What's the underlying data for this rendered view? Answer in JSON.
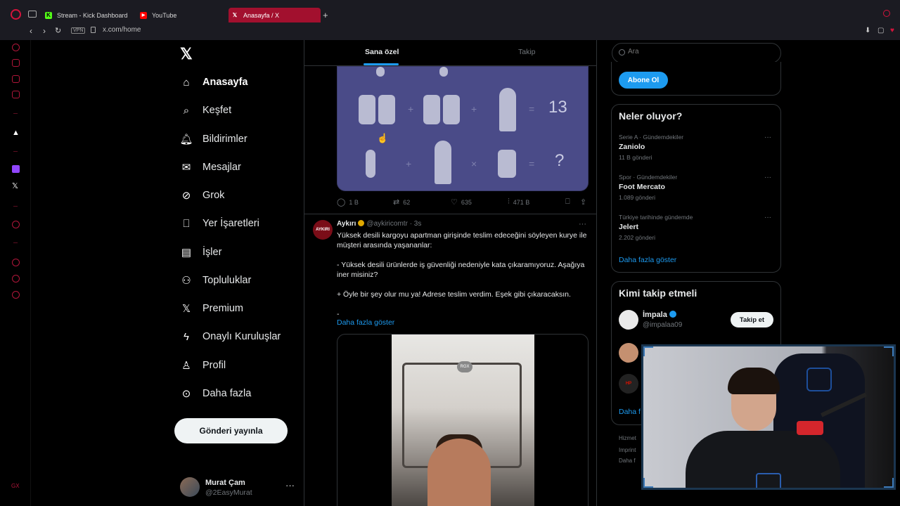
{
  "browser": {
    "tabs": [
      {
        "label": "Stream - Kick Dashboard",
        "icon": "kick-icon",
        "color": "#53fc18"
      },
      {
        "label": "YouTube",
        "icon": "youtube-icon",
        "color": "#ff0000"
      },
      {
        "label": "Anasayfa / X",
        "icon": "x-icon",
        "active": true
      }
    ],
    "vpn_label": "VPN",
    "url": "x.com/home"
  },
  "nav": {
    "items": [
      {
        "label": "Anasayfa",
        "icon": "home-icon",
        "active": true
      },
      {
        "label": "Keşfet",
        "icon": "search-icon"
      },
      {
        "label": "Bildirimler",
        "icon": "bell-icon"
      },
      {
        "label": "Mesajlar",
        "icon": "mail-icon"
      },
      {
        "label": "Grok",
        "icon": "grok-icon"
      },
      {
        "label": "Yer İşaretleri",
        "icon": "bookmark-icon"
      },
      {
        "label": "İşler",
        "icon": "briefcase-icon"
      },
      {
        "label": "Topluluklar",
        "icon": "communities-icon"
      },
      {
        "label": "Premium",
        "icon": "x-icon"
      },
      {
        "label": "Onaylı Kuruluşlar",
        "icon": "lightning-icon"
      },
      {
        "label": "Profil",
        "icon": "person-icon"
      },
      {
        "label": "Daha fazla",
        "icon": "more-circle-icon"
      }
    ],
    "post_button": "Gönderi yayınla",
    "account": {
      "name": "Murat Çam",
      "handle": "@2EasyMurat"
    }
  },
  "feed": {
    "tabs": [
      "Sana özel",
      "Takip"
    ],
    "active_tab": 0,
    "puzzle": {
      "result": "13",
      "question": "?"
    },
    "prev_tweet_stats": {
      "replies": "1 B",
      "retweets": "62",
      "likes": "635",
      "views": "471 B"
    },
    "tweet": {
      "avatar_text": "AYKIRI",
      "name": "Aykırı",
      "handle": "@aykiricomtr",
      "time": "· 3s",
      "body": "Yüksek desili kargoyu apartman girişinde teslim edeceğini söyleyen kurye ile müşteri arasında yaşananlar:\n\n- Yüksek desili ürünlerde iş güvenliği nedeniyle kata çıkaramıyoruz. Aşağıya iner misiniz?\n\n+ Öyle bir şey olur mu ya! Adrese teslim verdim. Eşek gibi çıkaracaksın.\n\n-",
      "show_more": "Daha fazla göster",
      "media_badge": "RGX"
    }
  },
  "right": {
    "search_placeholder": "Ara",
    "subscribe_button": "Abone Ol",
    "trends_title": "Neler oluyor?",
    "trends": [
      {
        "meta": "Serie A · Gündemdekiler",
        "name": "Zaniolo",
        "count": "11 B gönderi"
      },
      {
        "meta": "Spor · Gündemdekiler",
        "name": "Foot Mercato",
        "count": "1.089 gönderi"
      },
      {
        "meta": "Türkiye tarihinde gündemde",
        "name": "Jelert",
        "count": "2.202 gönderi"
      }
    ],
    "trends_more": "Daha fazla göster",
    "follow_title": "Kimi takip etmeli",
    "follow": [
      {
        "name": "İmpala",
        "handle": "@impalaa09",
        "button": "Takip et"
      }
    ],
    "follow_more": "Daha f",
    "third_avatar_text": "HP",
    "footer": [
      "Hizmet",
      "Imprint",
      "Daha f"
    ]
  }
}
